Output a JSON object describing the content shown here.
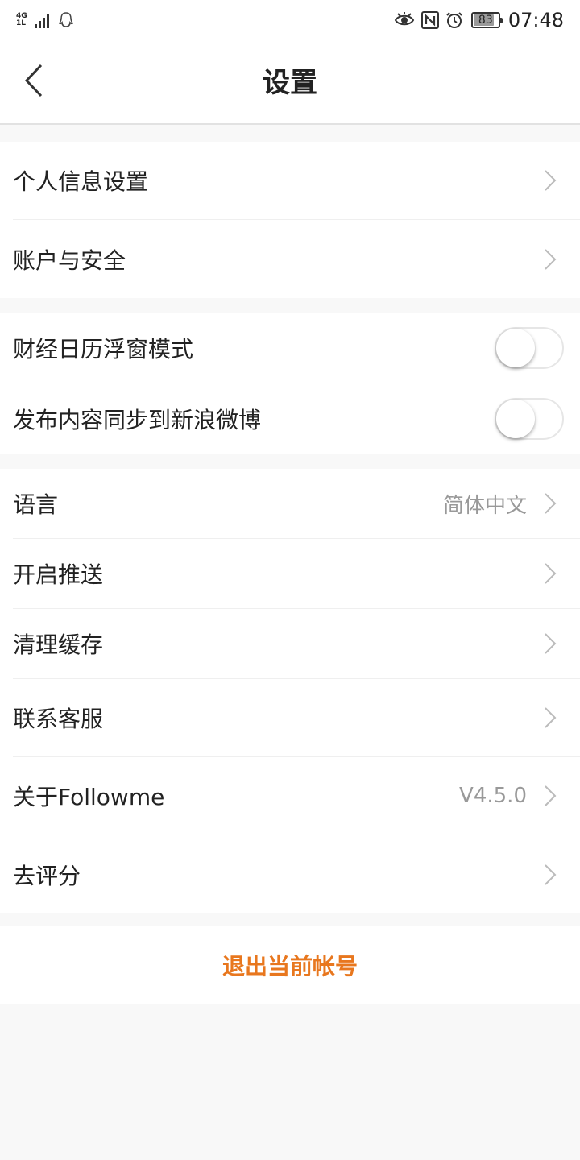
{
  "status_bar": {
    "network": "4G",
    "network_sub": "1L",
    "time": "07:48",
    "battery": "83",
    "battery_level": 0.83,
    "icons": [
      "signal-icon",
      "qq-icon",
      "eye-icon",
      "nfc-icon",
      "alarm-icon",
      "battery-icon"
    ]
  },
  "header": {
    "title": "设置",
    "back_icon": "back-arrow-icon"
  },
  "groups": [
    {
      "items": [
        {
          "label": "个人信息设置"
        },
        {
          "label": "账户与安全"
        }
      ]
    },
    {
      "items": [
        {
          "label": "财经日历浮窗模式",
          "toggle": false
        },
        {
          "label": "发布内容同步到新浪微博",
          "toggle": false
        }
      ]
    },
    {
      "items": [
        {
          "label": "语言",
          "value": "简体中文"
        },
        {
          "label": "开启推送"
        },
        {
          "label": "清理缓存"
        },
        {
          "label": "联系客服"
        },
        {
          "label": "关于Followme",
          "value": "V4.5.0"
        },
        {
          "label": "去评分"
        }
      ]
    }
  ],
  "logout": {
    "label": "退出当前帐号",
    "color": "#e8771e"
  }
}
